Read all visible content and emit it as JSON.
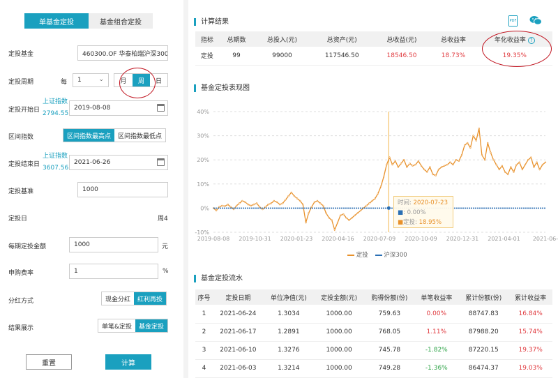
{
  "tabs": [
    "单基金定投",
    "基金组合定投"
  ],
  "form": {
    "fund_label": "定投基金",
    "fund_value": "460300.OF 华泰柏瑞沪深300",
    "period_label": "定投周期",
    "every": "每",
    "period_num": "1",
    "period_opts": [
      "月",
      "周",
      "日"
    ],
    "start_label": "定投开始日",
    "start_index_link": "上证指数",
    "start_index_val": "2794.55",
    "start_date": "2019-08-08",
    "range_label": "区间指数",
    "range_opts": [
      "区间指数最高点",
      "区间指数最低点"
    ],
    "end_label": "定投结束日",
    "end_index_link": "上证指数",
    "end_index_val": "3607.56",
    "end_date": "2021-06-26",
    "base_label": "定投基准",
    "base_value": "1000",
    "day_label": "定投日",
    "day_value": "周4",
    "amount_label": "每期定投金额",
    "amount_value": "1000",
    "amount_unit": "元",
    "fee_label": "申购费率",
    "fee_value": "1",
    "fee_unit": "%",
    "dividend_label": "分红方式",
    "dividend_opts": [
      "现金分红",
      "红利再投"
    ],
    "display_label": "结果展示",
    "display_opts": [
      "单笔&定投",
      "基金定投"
    ],
    "reset": "重置",
    "calc": "计算"
  },
  "results": {
    "title": "计算结果",
    "pdf": "PDF",
    "headers": [
      "指标",
      "总期数",
      "总投入(元)",
      "总资产(元)",
      "总收益(元)",
      "总收益率",
      "年化收益率"
    ],
    "help": "?",
    "row": [
      "定投",
      "99",
      "99000",
      "117546.50",
      "18546.50",
      "18.73%",
      "19.35%"
    ]
  },
  "chart_title": "基金定投表现图",
  "chart_data": {
    "type": "line",
    "x_ticks": [
      "2019-08-08",
      "2019-10-31",
      "2020-01-23",
      "2020-04-16",
      "2020-07-09",
      "2020-10-09",
      "2020-12-31",
      "2021-04-01",
      "2021-06-"
    ],
    "y_ticks": [
      "40%",
      "30%",
      "20%",
      "10%",
      "0%",
      "-10%"
    ],
    "ylim": [
      -10,
      40
    ],
    "series": [
      {
        "name": "定投",
        "color": "#e8912b",
        "values": [
          0,
          -1,
          0.5,
          1,
          0.8,
          1.5,
          0.5,
          -0.5,
          1,
          2,
          3,
          2.5,
          1.5,
          1,
          1.5,
          2,
          0.5,
          -0.5,
          0.5,
          1.5,
          2,
          3,
          2.5,
          1.5,
          2,
          3.5,
          5,
          6.5,
          5,
          4,
          3,
          1.5,
          -6,
          -2,
          0.5,
          2.5,
          3,
          2,
          1,
          -2,
          -4,
          -5,
          -9,
          -6,
          -3,
          -2.5,
          -4,
          -5,
          -4,
          -3,
          -2,
          -1,
          0,
          1,
          2,
          3,
          4,
          6,
          9,
          13,
          18,
          21,
          18,
          19.5,
          17,
          18.5,
          20,
          17,
          18.5,
          17.5,
          18,
          19.5,
          17.5,
          16,
          15,
          17,
          14,
          13.5,
          16,
          17,
          17.5,
          18,
          19,
          18,
          20,
          19.5,
          22,
          26,
          27,
          25,
          30,
          28,
          33,
          22,
          20,
          27,
          23,
          20,
          18,
          16,
          17.5,
          15,
          14,
          17,
          15,
          18,
          19,
          16,
          18,
          20,
          21,
          17,
          19,
          16,
          18,
          18.95
        ]
      },
      {
        "name": "沪深300",
        "color": "#2a6fb4",
        "values": [
          0,
          0,
          0,
          0,
          0,
          0,
          0,
          0,
          0,
          0,
          0,
          0,
          0,
          0,
          0,
          0,
          0,
          0,
          0,
          0,
          0,
          0,
          0,
          0,
          0,
          0,
          0,
          0,
          0,
          0,
          0,
          0,
          0,
          0,
          0,
          0,
          0,
          0,
          0,
          0,
          0,
          0,
          0,
          0,
          0,
          0,
          0,
          0,
          0,
          0,
          0,
          0,
          0,
          0,
          0,
          0,
          0,
          0,
          0,
          0,
          0,
          0,
          0,
          0,
          0,
          0,
          0,
          0,
          0,
          0,
          0,
          0,
          0,
          0,
          0,
          0,
          0,
          0,
          0,
          0,
          0,
          0,
          0,
          0,
          0,
          0,
          0,
          0,
          0,
          0,
          0,
          0,
          0,
          0,
          0,
          0,
          0,
          0,
          0,
          0,
          0,
          0,
          0,
          0,
          0,
          0,
          0,
          0,
          0,
          0,
          0,
          0,
          0,
          0,
          0,
          0
        ]
      }
    ],
    "tooltip": {
      "time_label": "时间:",
      "time": "2020-07-23",
      "index_label": ":",
      "index_value": "0.00%",
      "dt_label": "定投:",
      "dt_value": "18.95%"
    }
  },
  "flow": {
    "title": "基金定投流水",
    "headers": [
      "序号",
      "定投日期",
      "单位净值(元)",
      "定投金额(元)",
      "购得份额(份)",
      "单笔收益率",
      "累计份额(份)",
      "累计收益率"
    ],
    "rows": [
      [
        "1",
        "2021-06-24",
        "1.3034",
        "1000.00",
        "759.63",
        "0.00%",
        "88747.83",
        "16.84%"
      ],
      [
        "2",
        "2021-06-17",
        "1.2891",
        "1000.00",
        "768.05",
        "1.11%",
        "87988.20",
        "15.74%"
      ],
      [
        "3",
        "2021-06-10",
        "1.3276",
        "1000.00",
        "745.78",
        "-1.82%",
        "87220.15",
        "19.37%"
      ],
      [
        "4",
        "2021-06-03",
        "1.3214",
        "1000.00",
        "749.28",
        "-1.36%",
        "86474.37",
        "19.03%"
      ]
    ]
  }
}
